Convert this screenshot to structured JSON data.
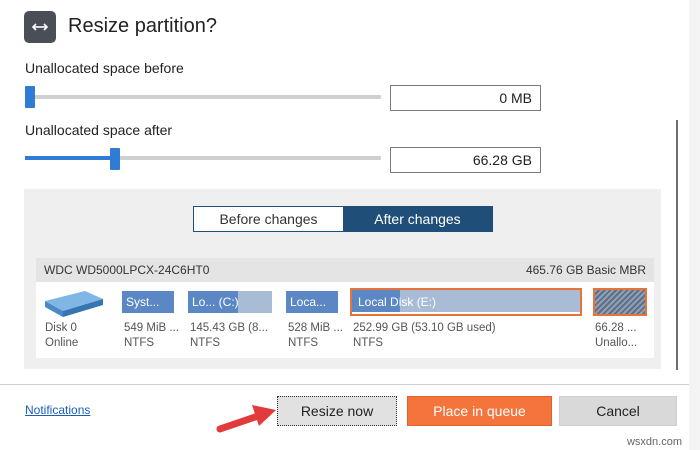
{
  "dialog": {
    "title": "Resize partition?",
    "title_icon": "resize-arrows-icon"
  },
  "before": {
    "label": "Unallocated space before",
    "value": "0 MB",
    "slider_fraction": 0.0
  },
  "after": {
    "label": "Unallocated space after",
    "value": "66.28 GB",
    "slider_fraction": 0.25
  },
  "view_toggle": {
    "before_label": "Before changes",
    "after_label": "After changes",
    "selected": "After changes"
  },
  "disk": {
    "name": "WDC WD5000LPCX-24C6HT0",
    "info": "465.76 GB Basic MBR",
    "disk_label": "Disk 0",
    "status": "Online",
    "partitions": [
      {
        "label": "Syst...",
        "size": "549 MiB ...",
        "fs": "NTFS",
        "color": "#5b87c5",
        "fill": 1.0
      },
      {
        "label": "Lo...  (C:)",
        "size": "145.43 GB (8...",
        "fs": "NTFS",
        "color": "#5b87c5",
        "fill": 0.6
      },
      {
        "label": "Loca...",
        "size": "528 MiB ...",
        "fs": "NTFS",
        "color": "#5b87c5",
        "fill": 1.0
      },
      {
        "label": "Local Disk (E:)",
        "size": "252.99 GB (53.10 GB used)",
        "fs": "NTFS",
        "color": "#5b87c5",
        "fill": 0.21
      },
      {
        "label": "",
        "size": "66.28 ...",
        "fs": "Unallo...",
        "color": "#8f9fb5",
        "fill": 1.0
      }
    ]
  },
  "footer": {
    "notifications": "Notifications",
    "resize_now": "Resize now",
    "place_in_queue": "Place in queue",
    "cancel": "Cancel"
  },
  "annotation": {
    "arrow_color": "#e23b3b"
  },
  "watermark": "wsxdn.com",
  "colors": {
    "accent": "#2f7bd6",
    "toggle": "#1f4e79",
    "queue": "#f4743b",
    "highlight": "#e8733a"
  }
}
